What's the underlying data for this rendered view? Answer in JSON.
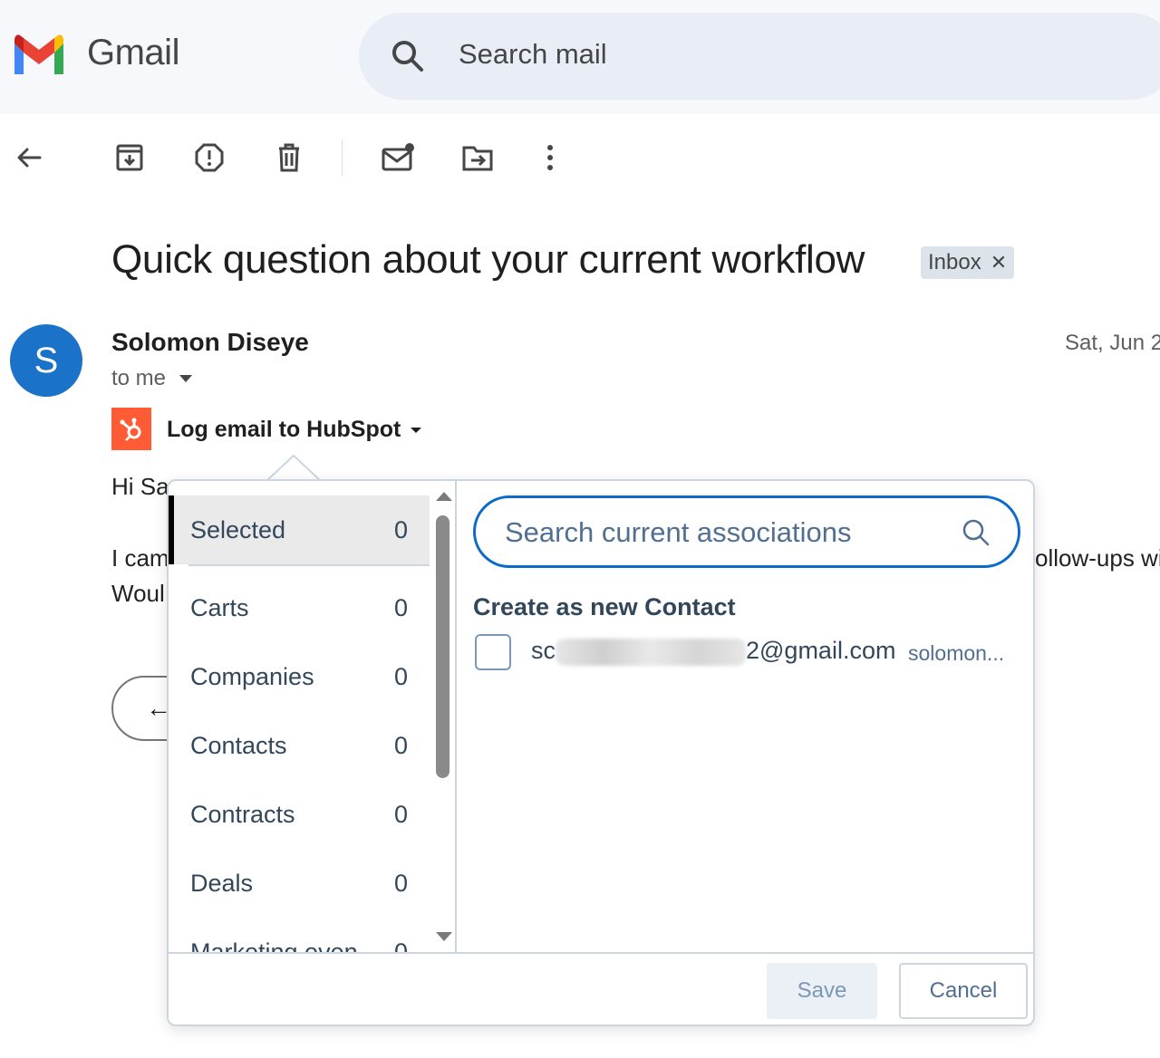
{
  "app": {
    "brand": "Gmail"
  },
  "search": {
    "placeholder": "Search mail"
  },
  "email": {
    "subject": "Quick question about your current workflow",
    "label": "Inbox",
    "sender": "Solomon Diseye",
    "avatar_letter": "S",
    "recipient": "to me",
    "date": "Sat, Jun 2",
    "body_greeting_visible": "Hi Sa",
    "body_line1_visible": "I cam",
    "body_line2_visible": "Woul",
    "body_line1_right_visible": "ollow-ups wi"
  },
  "hubspot": {
    "log_label": "Log email to HubSpot",
    "categories": [
      {
        "label": "Selected",
        "count": "0"
      },
      {
        "label": "Carts",
        "count": "0"
      },
      {
        "label": "Companies",
        "count": "0"
      },
      {
        "label": "Contacts",
        "count": "0"
      },
      {
        "label": "Contracts",
        "count": "0"
      },
      {
        "label": "Deals",
        "count": "0"
      },
      {
        "label": "Marketing even",
        "count": "0"
      }
    ],
    "search_placeholder": "Search current associations",
    "create_title": "Create as new Contact",
    "email_prefix": "sc",
    "email_suffix": "2@gmail.com",
    "email_hint": "solomon...",
    "save_label": "Save",
    "cancel_label": "Cancel"
  },
  "colors": {
    "hubspot_orange": "#ff5c35",
    "avatar_blue": "#1a73c8",
    "focus_blue": "#0b6cc7"
  }
}
